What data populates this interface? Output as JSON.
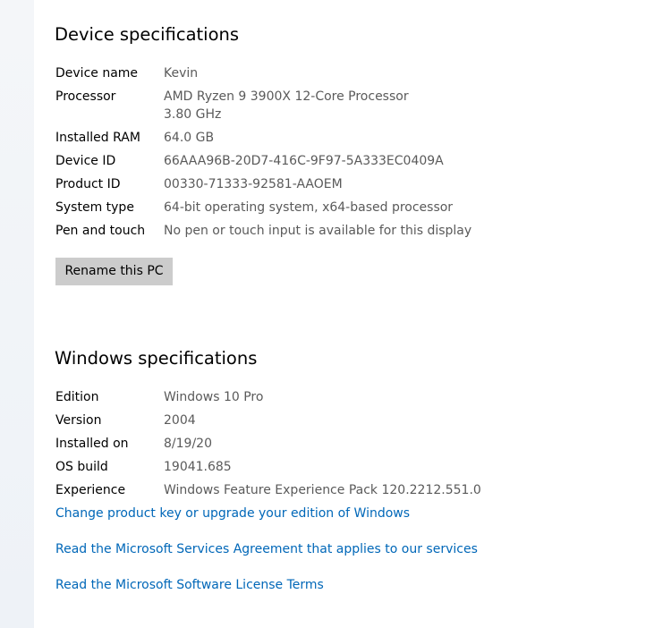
{
  "device_specs": {
    "title": "Device specifications",
    "rows": [
      {
        "label": "Device name",
        "value": "Kevin"
      },
      {
        "label": "Processor",
        "value": "AMD Ryzen 9 3900X 12-Core Processor",
        "value_line2": "3.80 GHz"
      },
      {
        "label": "Installed RAM",
        "value": "64.0 GB"
      },
      {
        "label": "Device ID",
        "value": "66AAA96B-20D7-416C-9F97-5A333EC0409A"
      },
      {
        "label": "Product ID",
        "value": "00330-71333-92581-AAOEM"
      },
      {
        "label": "System type",
        "value": "64-bit operating system, x64-based processor"
      },
      {
        "label": "Pen and touch",
        "value": "No pen or touch input is available for this display"
      }
    ],
    "rename_button": "Rename this PC"
  },
  "windows_specs": {
    "title": "Windows specifications",
    "rows": [
      {
        "label": "Edition",
        "value": "Windows 10 Pro"
      },
      {
        "label": "Version",
        "value": "2004"
      },
      {
        "label": "Installed on",
        "value": "8/19/20"
      },
      {
        "label": "OS build",
        "value": "19041.685"
      },
      {
        "label": "Experience",
        "value": "Windows Feature Experience Pack 120.2212.551.0"
      }
    ]
  },
  "links": {
    "change_key": "Change product key or upgrade your edition of Windows",
    "services_agreement": "Read the Microsoft Services Agreement that applies to our services",
    "license_terms": "Read the Microsoft Software License Terms"
  },
  "colors": {
    "link": "#0067b8",
    "value_text": "#5a5a5a",
    "button_bg": "#cccccc"
  }
}
